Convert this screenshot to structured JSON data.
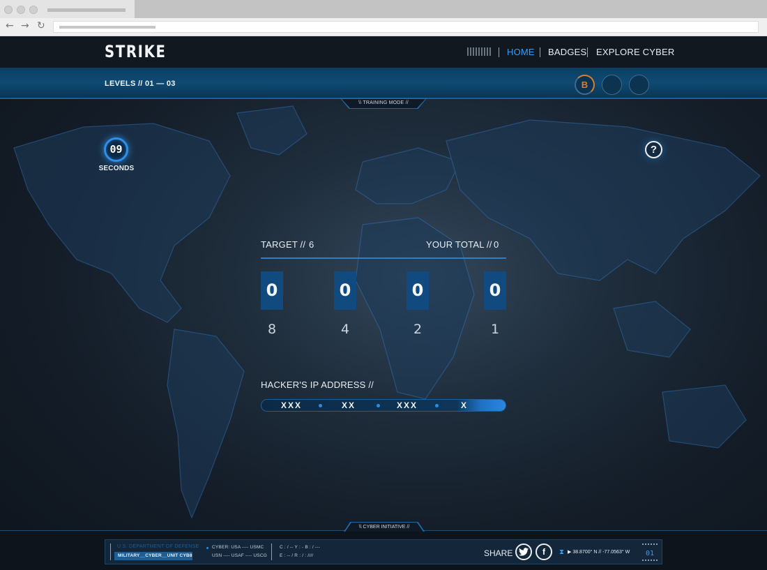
{
  "app": {
    "logo": "STRIKE",
    "nav": [
      {
        "label": "HOME",
        "active": true
      },
      {
        "label": "BADGES",
        "active": false
      },
      {
        "label": "EXPLORE CYBER",
        "active": false
      }
    ],
    "levels": "LEVELS // 01 — 03",
    "badges": [
      {
        "icon": "badge-b-icon",
        "text": "B"
      },
      {
        "icon": "badge-empty-icon",
        "text": ""
      },
      {
        "icon": "badge-empty-icon",
        "text": ""
      }
    ],
    "mode": "\\\\ TRAINING MODE //"
  },
  "timer": {
    "value": "09",
    "unit": "SECONDS"
  },
  "help_icon": "?",
  "game": {
    "target_label": "TARGET //",
    "target_value": "6",
    "total_label": "YOUR TOTAL //",
    "total_value": "0",
    "bits": [
      {
        "value": "0",
        "weight": "8"
      },
      {
        "value": "0",
        "weight": "4"
      },
      {
        "value": "0",
        "weight": "2"
      },
      {
        "value": "0",
        "weight": "1"
      }
    ],
    "ip_label": "HACKER'S IP ADDRESS //",
    "ip_segments": [
      "XXX",
      "XX",
      "XXX",
      "X"
    ]
  },
  "footer": {
    "initiative": "\\\\ CYBER INITIATIVE //",
    "department": "U.S. DEPARTMENT OF DEFENSE",
    "unit": "MILITARY__CYBER__UNIT CYB8",
    "branches_line1": "CYBER: USA ---- USMC",
    "branches_line2": "USN ---- USAF ---- USCG",
    "codes_line1": "C : / --    Y : -      B : / ---",
    "codes_line2": "E : -- /    R : /      : ////",
    "share": "SHARE",
    "social": [
      {
        "icon": "twitter-icon"
      },
      {
        "icon": "facebook-icon"
      }
    ],
    "coords": "▶ 38.8700° N // -77.0563° W",
    "page": "01"
  },
  "colors": {
    "accent": "#3c9cf0",
    "bit_box": "#114a7e",
    "orange": "#d6812a"
  }
}
